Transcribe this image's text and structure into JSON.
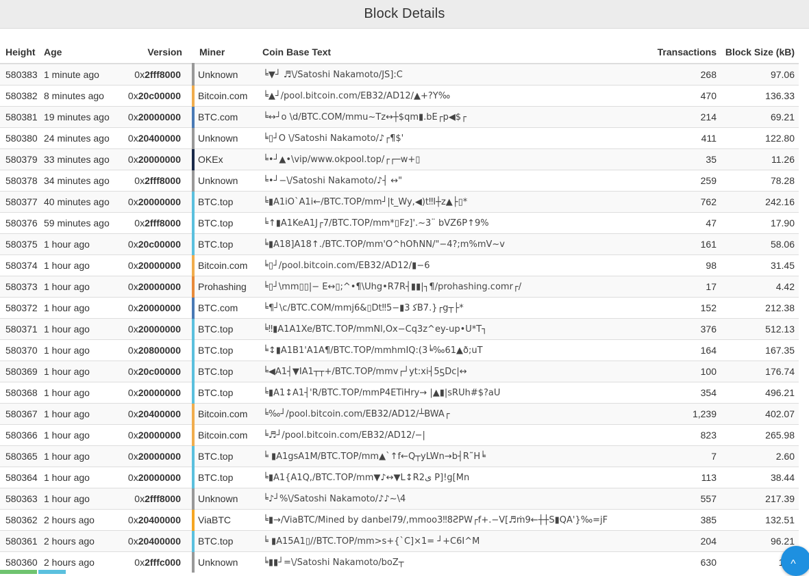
{
  "page": {
    "title": "Block Details"
  },
  "columns": {
    "height": "Height",
    "age": "Age",
    "version": "Version",
    "miner": "Miner",
    "coinbase": "Coin Base Text",
    "transactions": "Transactions",
    "size": "Block Size (kB)"
  },
  "miner_colors": {
    "Unknown": "#999999",
    "Bitcoin.com": "#f0ad4e",
    "BTC.com": "#4a7ab5",
    "OKEx": "#1a2a4a",
    "BTC.top": "#5bc0de",
    "Prohashing": "#e88a3a",
    "ViaBTC": "#f5a623"
  },
  "blocks": [
    {
      "height": "580383",
      "age": "1 minute ago",
      "version_prefix": "0x",
      "version_value": "2fff8000",
      "miner": "Unknown",
      "coinbase": "╘▼┘ ♬\\/Satoshi Nakamoto/JS]:C",
      "transactions": "268",
      "size": "97.06"
    },
    {
      "height": "580382",
      "age": "8 minutes ago",
      "version_prefix": "0x",
      "version_value": "20c00000",
      "miner": "Bitcoin.com",
      "coinbase": "╘▲┘/pool.bitcoin.com/EB32/AD12/▲+?Y‰",
      "transactions": "470",
      "size": "136.33"
    },
    {
      "height": "580381",
      "age": "19 minutes ago",
      "version_prefix": "0x",
      "version_value": "20000000",
      "miner": "BTC.com",
      "coinbase": "╘↔┘o \\d/BTC.COM/mmu~Tz↔┼$qm▮.bE┌p◀$┌",
      "transactions": "214",
      "size": "69.21"
    },
    {
      "height": "580380",
      "age": "24 minutes ago",
      "version_prefix": "0x",
      "version_value": "20400000",
      "miner": "Unknown",
      "coinbase": "╘▯┘O \\/Satoshi Nakamoto/♪┌¶$'",
      "transactions": "411",
      "size": "122.80"
    },
    {
      "height": "580379",
      "age": "33 minutes ago",
      "version_prefix": "0x",
      "version_value": "20000000",
      "miner": "OKEx",
      "coinbase": "╘•┘▲•\\vip/www.okpool.top/┌┌─w+▯",
      "transactions": "35",
      "size": "11.26"
    },
    {
      "height": "580378",
      "age": "34 minutes ago",
      "version_prefix": "0x",
      "version_value": "2fff8000",
      "miner": "Unknown",
      "coinbase": "╘•┘−\\/Satoshi Nakamoto/♪┤ ↔\"",
      "transactions": "259",
      "size": "78.28"
    },
    {
      "height": "580377",
      "age": "40 minutes ago",
      "version_prefix": "0x",
      "version_value": "20000000",
      "miner": "BTC.top",
      "coinbase": "╘▮A1iO`A1i←/BTC.TOP/mm┘|t_Wy,◀)t‼I┼z▲├▯*",
      "transactions": "762",
      "size": "242.16"
    },
    {
      "height": "580376",
      "age": "59 minutes ago",
      "version_prefix": "0x",
      "version_value": "2fff8000",
      "miner": "BTC.top",
      "coinbase": "╘↑▮A1KeA1J┌7/BTC.TOP/mm*▯Fz]'.~3¨ bVZ6P↑9%",
      "transactions": "47",
      "size": "17.90"
    },
    {
      "height": "580375",
      "age": "1 hour ago",
      "version_prefix": "0x",
      "version_value": "20c00000",
      "miner": "BTC.top",
      "coinbase": "╘▮A18]A18↑./BTC.TOP/mm'O^hOħNN/\"−4?;m%mV~v",
      "transactions": "161",
      "size": "58.06"
    },
    {
      "height": "580374",
      "age": "1 hour ago",
      "version_prefix": "0x",
      "version_value": "20000000",
      "miner": "Bitcoin.com",
      "coinbase": "╘▯┘/pool.bitcoin.com/EB32/AD12/▮−6",
      "transactions": "98",
      "size": "31.45"
    },
    {
      "height": "580373",
      "age": "1 hour ago",
      "version_prefix": "0x",
      "version_value": "20000000",
      "miner": "Prohashing",
      "coinbase": "╘▯┘\\mm▯▯|− E↔▯;^•¶\\Uhg•R7R┤▮▮|┐¶/prohashing.comr┌/",
      "transactions": "17",
      "size": "4.42"
    },
    {
      "height": "580372",
      "age": "1 hour ago",
      "version_prefix": "0x",
      "version_value": "20000000",
      "miner": "BTC.com",
      "coinbase": "╘¶┘\\c/BTC.COM/mmj6&▯Dt‼5−▮3 ﮐB7.}┌g┬├*",
      "transactions": "152",
      "size": "212.38"
    },
    {
      "height": "580371",
      "age": "1 hour ago",
      "version_prefix": "0x",
      "version_value": "20000000",
      "miner": "BTC.top",
      "coinbase": "╘‼▮A1A1Xe/BTC.TOP/mmNl,Ox−Cq3z^ey-up•U*T┐",
      "transactions": "376",
      "size": "512.13"
    },
    {
      "height": "580370",
      "age": "1 hour ago",
      "version_prefix": "0x",
      "version_value": "20800000",
      "miner": "BTC.top",
      "coinbase": "╘↕▮A1B1'A1A¶/BTC.TOP/mmhmIQ:(3╘‰61▲ð;uT",
      "transactions": "164",
      "size": "167.35"
    },
    {
      "height": "580369",
      "age": "1 hour ago",
      "version_prefix": "0x",
      "version_value": "20c00000",
      "miner": "BTC.top",
      "coinbase": "╘◀A1┤▼IA1┬┬+/BTC.TOP/mmv┌┘yt:xi┤5ƽDc|↔",
      "transactions": "100",
      "size": "176.74"
    },
    {
      "height": "580368",
      "age": "1 hour ago",
      "version_prefix": "0x",
      "version_value": "20000000",
      "miner": "BTC.top",
      "coinbase": "╘▮A1↕A1┤'R/BTC.TOP/mmP4ETiHry→ |▲▮|sRUh#$?aU",
      "transactions": "354",
      "size": "496.21"
    },
    {
      "height": "580367",
      "age": "1 hour ago",
      "version_prefix": "0x",
      "version_value": "20400000",
      "miner": "Bitcoin.com",
      "coinbase": "╘‰┘/pool.bitcoin.com/EB32/AD12/┴BWA┌",
      "transactions": "1,239",
      "size": "402.07"
    },
    {
      "height": "580366",
      "age": "1 hour ago",
      "version_prefix": "0x",
      "version_value": "20000000",
      "miner": "Bitcoin.com",
      "coinbase": "╘♬┘/pool.bitcoin.com/EB32/AD12/−|",
      "transactions": "823",
      "size": "265.98"
    },
    {
      "height": "580365",
      "age": "1 hour ago",
      "version_prefix": "0x",
      "version_value": "20000000",
      "miner": "BTC.top",
      "coinbase": "╘ ▮A1gsA1M/BTC.TOP/mm▲`↑f←Q┬yLWn→b┤R˜H╘",
      "transactions": "7",
      "size": "2.60"
    },
    {
      "height": "580364",
      "age": "1 hour ago",
      "version_prefix": "0x",
      "version_value": "20000000",
      "miner": "BTC.top",
      "coinbase": "╘▮A1{A1Q,/BTC.TOP/mm▼♪↔▼L↕R2ی P]!g[Mn",
      "transactions": "113",
      "size": "38.44"
    },
    {
      "height": "580363",
      "age": "1 hour ago",
      "version_prefix": "0x",
      "version_value": "2fff8000",
      "miner": "Unknown",
      "coinbase": "╘♪┘%\\/Satoshi Nakamoto/♪♪~\\4",
      "transactions": "557",
      "size": "217.39"
    },
    {
      "height": "580362",
      "age": "2 hours ago",
      "version_prefix": "0x",
      "version_value": "20400000",
      "miner": "ViaBTC",
      "coinbase": "╘▮→/ViaBTC/Mined by danbel79/,mmoo3‼8ƧPW┌f+.−V[♬ṁ9←┼┼S▮QA'}‰=jF",
      "transactions": "385",
      "size": "132.51"
    },
    {
      "height": "580361",
      "age": "2 hours ago",
      "version_prefix": "0x",
      "version_value": "20400000",
      "miner": "BTC.top",
      "coinbase": "╘ ▮A15A1▯//BTC.TOP/mm>s+{`C]×1= ┘+C6I^M",
      "transactions": "204",
      "size": "96.21"
    },
    {
      "height": "580360",
      "age": "2 hours ago",
      "version_prefix": "0x",
      "version_value": "2fffc000",
      "miner": "Unknown",
      "coinbase": "╘▮▮┘=\\/Satoshi Nakamoto/boZ┬",
      "transactions": "630",
      "size": "198"
    }
  ],
  "scroll_button": {
    "icon": "chevron-up-icon",
    "glyph": "^"
  }
}
